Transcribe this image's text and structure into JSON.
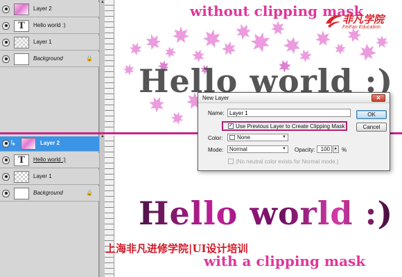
{
  "layers_top": [
    {
      "name": "Layer 2",
      "thumb": "pink",
      "style": "normal"
    },
    {
      "name": "Hello world :)",
      "thumb": "text",
      "style": "normal"
    },
    {
      "name": "Layer 1",
      "thumb": "checker",
      "style": "normal"
    },
    {
      "name": "Background",
      "thumb": "white",
      "style": "italic",
      "locked": true
    }
  ],
  "layers_bottom": [
    {
      "name": "Layer 2",
      "thumb": "pink",
      "style": "selected",
      "clipped": true
    },
    {
      "name": "Hello world :)",
      "thumb": "text",
      "style": "underline"
    },
    {
      "name": "Layer 1",
      "thumb": "checker",
      "style": "normal"
    },
    {
      "name": "Background",
      "thumb": "white",
      "style": "italic",
      "locked": true
    }
  ],
  "text_thumb_glyph": "T",
  "clip_arrow_glyph": "↳",
  "lock_glyph": "🔒",
  "captions": {
    "top": "without clipping mask",
    "bottom": "with a clipping mask"
  },
  "canvas_text": {
    "top": "Hello world :)",
    "bottom": "Hello world :)"
  },
  "logo": {
    "cn": "非凡学院",
    "en": "FeiFan Education"
  },
  "watermark": "上海非凡进修学院|UI设计培训",
  "dialog": {
    "title": "New Layer",
    "close_glyph": "✕",
    "name_label": "Name:",
    "name_value": "Layer 1",
    "clip_checkbox_label": "Use Previous Layer to Create Clipping Mask",
    "clip_checked": true,
    "color_label": "Color:",
    "color_value": "None",
    "mode_label": "Mode:",
    "mode_value": "Normal",
    "opacity_label": "Opacity:",
    "opacity_value": "100",
    "opacity_unit": "%",
    "neutral_label": "(No neutral color exists for Normal mode.)",
    "ok_label": "OK",
    "cancel_label": "Cancel"
  },
  "colors": {
    "accent_pink": "#e0369a",
    "divider": "#c8248a",
    "selected_layer": "#3b94e6",
    "watermark_red": "#d11a28"
  }
}
